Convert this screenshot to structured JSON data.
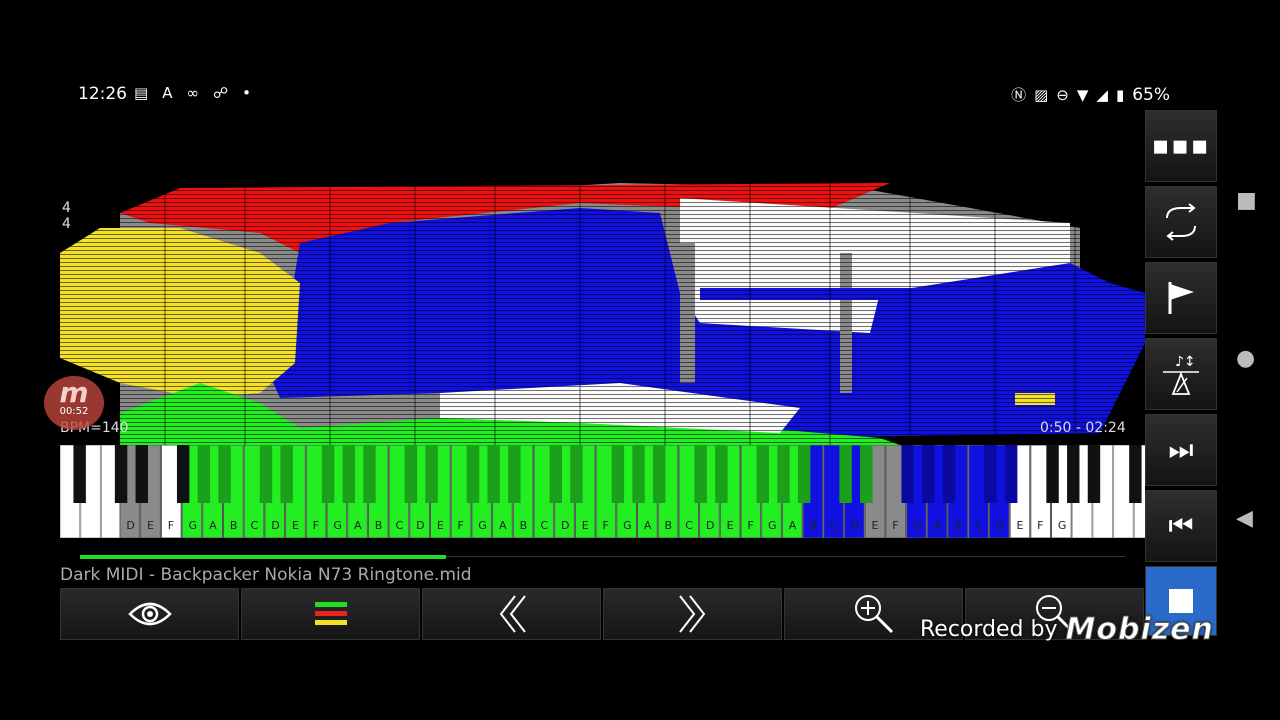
{
  "status_bar": {
    "time": "12:26",
    "left_icons": [
      "document-icon",
      "font-icon",
      "voicemail-icon",
      "missed-call-icon",
      "dot-icon"
    ],
    "right_icons": [
      "nfc-icon",
      "cast-icon",
      "dnd-icon",
      "wifi-icon",
      "signal-icon",
      "battery-icon"
    ],
    "battery": "65%"
  },
  "roll": {
    "time_signature_top": "4",
    "time_signature_bottom": "4",
    "bpm": "BPM=140",
    "timer": "0:50 - 02:24"
  },
  "recorder_badge": {
    "letter": "m",
    "time": "00:52"
  },
  "keyboard": {
    "note_names": [
      "D",
      "E",
      "F",
      "G",
      "A",
      "B",
      "C",
      "D",
      "E",
      "F",
      "G",
      "A",
      "B",
      "C",
      "D",
      "E",
      "F",
      "G",
      "A",
      "B",
      "C",
      "D",
      "E",
      "F",
      "G",
      "A",
      "B",
      "C",
      "D",
      "E",
      "F",
      "G",
      "A",
      "B",
      "C",
      "D",
      "E",
      "F",
      "G",
      "A",
      "B",
      "C",
      "D",
      "E",
      "F",
      "G"
    ],
    "green_color": "#22ee22",
    "blue_color": "#1010e0",
    "gray_color": "#8a8a8a"
  },
  "playback": {
    "progress": 0.35
  },
  "file": {
    "name": "Dark MIDI - Backpacker Nokia N73 Ringtone.mid"
  },
  "toolbar": {
    "buttons": [
      "eye-icon",
      "tracks-icon",
      "previous-icon",
      "next-icon",
      "zoom-in-icon",
      "zoom-out-icon"
    ]
  },
  "right_panel": {
    "buttons": [
      "more-icon",
      "loop-icon",
      "flag-icon",
      "metronome-icon",
      "fast-forward-icon",
      "rewind-icon",
      "stop-icon"
    ]
  },
  "watermark": {
    "prefix": "Recorded by",
    "brand": "Mobizen"
  }
}
